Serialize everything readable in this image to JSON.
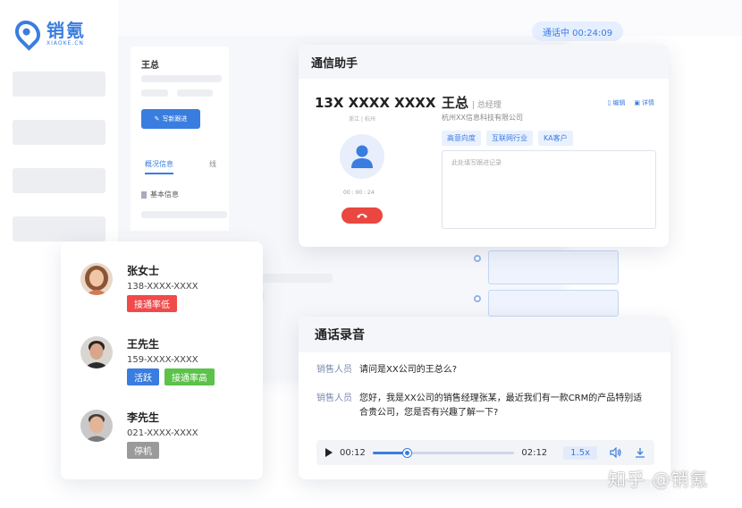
{
  "app": {
    "logo_cn": "销氪",
    "logo_en": "XIAOKE.CN",
    "call_status": "通话中 00:24:09",
    "detail_name": "王总",
    "follow_button": "写新跟进",
    "tab_overview": "概况信息",
    "tab_second": "线",
    "basic_info": "基本信息"
  },
  "assistant": {
    "title": "通信助手",
    "phone": "13X XXXX XXXX",
    "location": "浙江 | 杭州",
    "timer": "00 : 00 : 24",
    "contact_name": "王总",
    "contact_role": "| 总经理",
    "company": "杭州XX信息科技有限公司",
    "edit": "编辑",
    "detail": "详情",
    "tags": [
      "高意向度",
      "互联网行业",
      "KA客户"
    ],
    "note_placeholder": "此处填写跟进记录"
  },
  "contacts": [
    {
      "name": "张女士",
      "phone": "138-XXXX-XXXX",
      "tags": [
        {
          "label": "接通率低",
          "color": "#f04a4a"
        }
      ]
    },
    {
      "name": "王先生",
      "phone": "159-XXXX-XXXX",
      "tags": [
        {
          "label": "活跃",
          "color": "#3a7de0"
        },
        {
          "label": "接通率高",
          "color": "#5cc24a"
        }
      ]
    },
    {
      "name": "李先生",
      "phone": "021-XXXX-XXXX",
      "tags": [
        {
          "label": "停机",
          "color": "#9a9a9a"
        }
      ]
    }
  ],
  "recording": {
    "title": "通话录音",
    "lines": [
      {
        "speaker": "销售人员",
        "text": "请问是XX公司的王总么?"
      },
      {
        "speaker": "销售人员",
        "text": "您好，我是XX公司的销售经理张某，最近我们有一款CRM的产品特别适合贵公司，您是否有兴趣了解一下?"
      }
    ],
    "current_time": "00:12",
    "total_time": "02:12",
    "progress": 0.24,
    "speed": "1.5x"
  },
  "watermark": "知乎 @销氪",
  "colors": {
    "accent": "#3a7de0",
    "danger": "#e9473f"
  }
}
